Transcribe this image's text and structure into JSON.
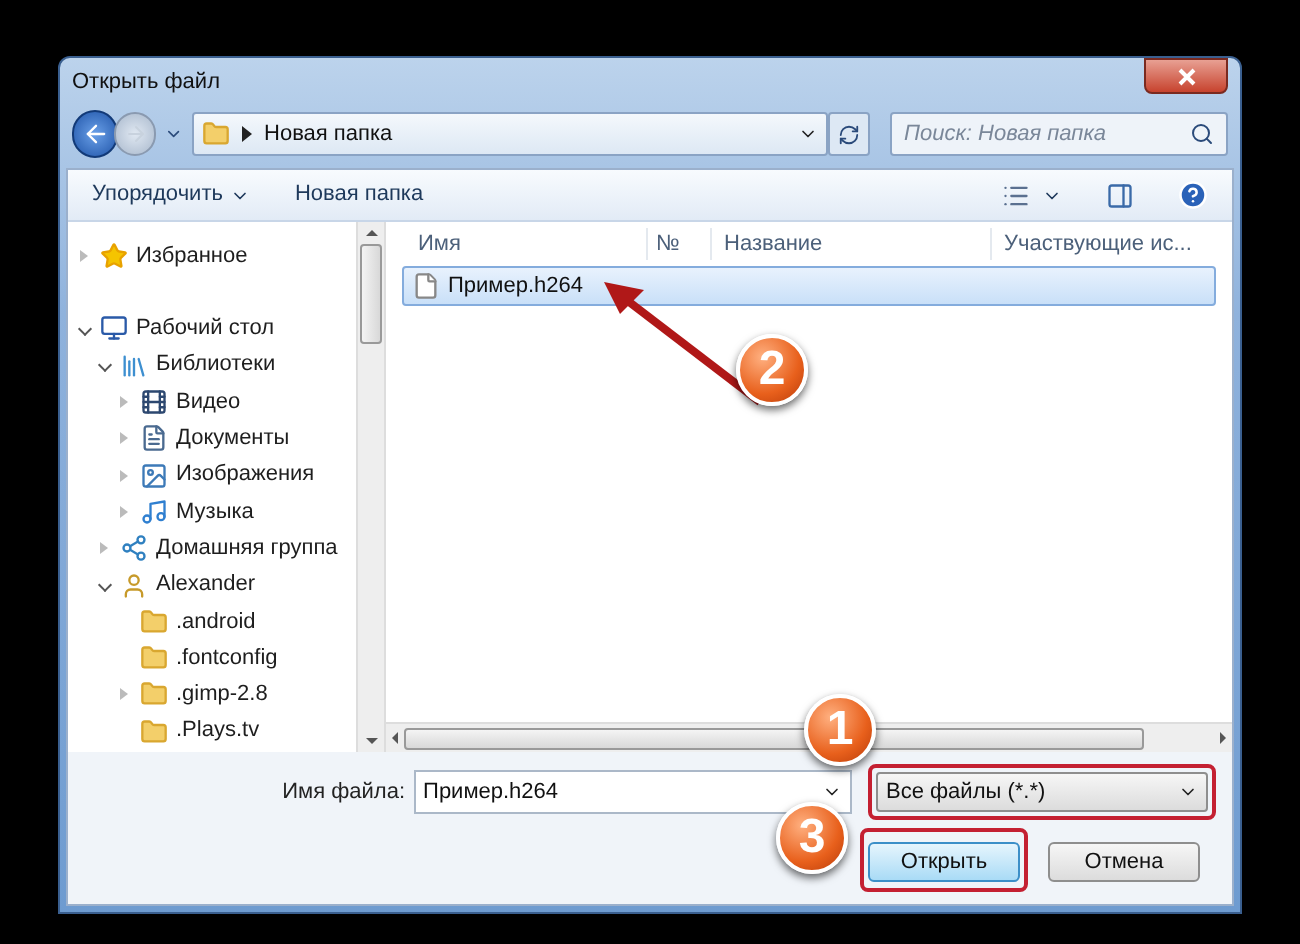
{
  "window": {
    "title": "Открыть файл"
  },
  "address_bar": {
    "path": "Новая папка"
  },
  "search": {
    "placeholder": "Поиск: Новая папка"
  },
  "toolbar": {
    "organize": "Упорядочить",
    "new_folder": "Новая папка"
  },
  "navigation": [
    {
      "label": "Избранное",
      "kind": "star",
      "expanded": false
    },
    {
      "label": "Рабочий стол",
      "kind": "desktop",
      "expanded": true,
      "children": [
        {
          "label": "Библиотеки",
          "kind": "library",
          "expanded": true,
          "children": [
            {
              "label": "Видео",
              "kind": "video",
              "expanded": false
            },
            {
              "label": "Документы",
              "kind": "document",
              "expanded": false
            },
            {
              "label": "Изображения",
              "kind": "image",
              "expanded": false
            },
            {
              "label": "Музыка",
              "kind": "music",
              "expanded": false
            }
          ]
        },
        {
          "label": "Домашняя группа",
          "kind": "homegroup",
          "expanded": false
        },
        {
          "label": "Alexander",
          "kind": "user",
          "expanded": true,
          "children": [
            {
              "label": ".android",
              "kind": "folder"
            },
            {
              "label": ".fontconfig",
              "kind": "folder"
            },
            {
              "label": ".gimp-2.8",
              "kind": "folder",
              "expanded": false
            },
            {
              "label": ".Plays.tv",
              "kind": "folder"
            }
          ]
        }
      ]
    }
  ],
  "columns": [
    "Имя",
    "№",
    "Название",
    "Участвующие ис..."
  ],
  "files": [
    {
      "name": "Пример.h264",
      "selected": true
    }
  ],
  "file_name": {
    "label": "Имя файла:",
    "value": "Пример.h264"
  },
  "file_type": {
    "value": "Все файлы (*.*)",
    "highlighted": true
  },
  "buttons": [
    {
      "label": "Открыть",
      "highlighted": true,
      "default": true
    },
    {
      "label": "Отмена",
      "highlighted": false,
      "default": false
    }
  ],
  "markers": [
    "1",
    "2",
    "3"
  ]
}
